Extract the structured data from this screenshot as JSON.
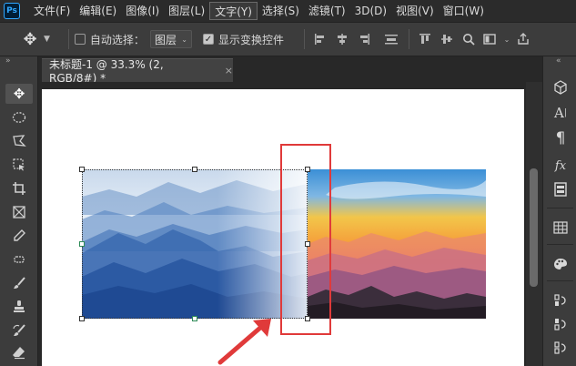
{
  "app": {
    "logo_text": "Ps",
    "menu": [
      "文件(F)",
      "编辑(E)",
      "图像(I)",
      "图层(L)",
      "文字(Y)",
      "选择(S)",
      "滤镜(T)",
      "3D(D)",
      "视图(V)",
      "窗口(W)"
    ],
    "active_menu_index": 4
  },
  "options_bar": {
    "auto_select_label": "自动选择：",
    "auto_select_checked": false,
    "target_select_value": "图层",
    "show_transform_label": "显示变换控件",
    "show_transform_checked": true
  },
  "document": {
    "tab_title": "未标题-1 @ 33.3% (2, RGB/8#) *",
    "close_glyph": "×"
  },
  "colors": {
    "annotation_red": "#e03a3a",
    "accent_blue": "#31a8ff",
    "ui_dark": "#282828",
    "ui_panel": "#3c3c3c"
  }
}
